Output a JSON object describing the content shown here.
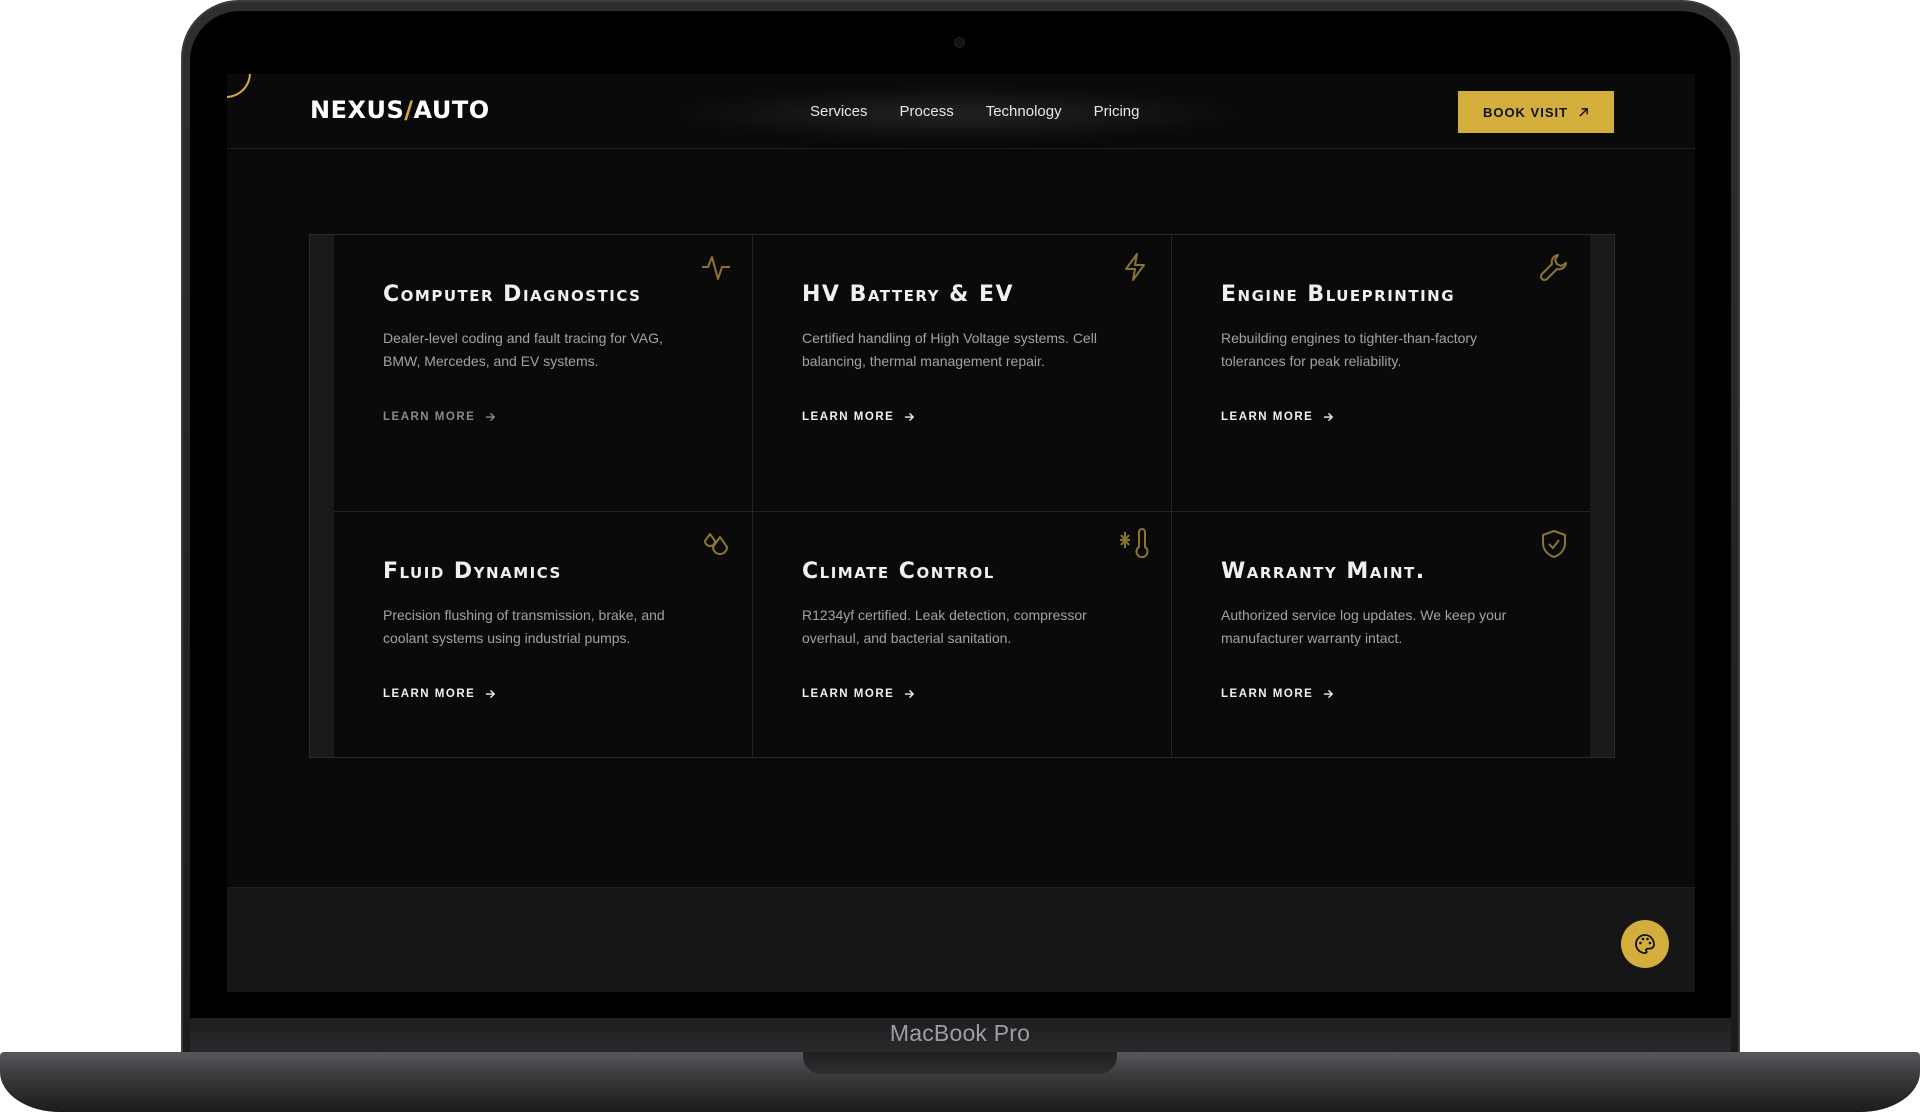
{
  "brand": {
    "name_left": "NEXUS",
    "separator": "/",
    "name_right": "AUTO"
  },
  "nav": {
    "links": [
      "Services",
      "Process",
      "Technology",
      "Pricing"
    ],
    "cta_label": "BOOK VISIT",
    "cta_icon": "arrow-up-right-icon"
  },
  "services": [
    {
      "title": "Computer Diagnostics",
      "desc": "Dealer-level coding and fault tracing for VAG, BMW, Mercedes, and EV systems.",
      "link": "LEARN MORE",
      "icon": "activity-pulse-icon"
    },
    {
      "title": "HV Battery & EV",
      "desc": "Certified handling of High Voltage systems. Cell balancing, thermal management repair.",
      "link": "LEARN MORE",
      "icon": "lightning-bolt-icon"
    },
    {
      "title": "Engine Blueprinting",
      "desc": "Rebuilding engines to tighter-than-factory tolerances for peak reliability.",
      "link": "LEARN MORE",
      "icon": "wrench-icon"
    },
    {
      "title": "Fluid Dynamics",
      "desc": "Precision flushing of transmission, brake, and coolant systems using industrial pumps.",
      "link": "LEARN MORE",
      "icon": "droplets-icon"
    },
    {
      "title": "Climate Control",
      "desc": "R1234yf certified. Leak detection, compressor overhaul, and bacterial sanitation.",
      "link": "LEARN MORE",
      "icon": "thermometer-snowflake-icon"
    },
    {
      "title": "Warranty Maint.",
      "desc": "Authorized service log updates. We keep your manufacturer warranty intact.",
      "link": "LEARN MORE",
      "icon": "shield-check-icon"
    }
  ],
  "floating_button": {
    "icon": "palette-icon"
  },
  "device": {
    "label": "MacBook Pro"
  },
  "colors": {
    "accent": "#d4ae3c",
    "background": "#0a0a0a",
    "text": "#f0f0f0",
    "muted": "#a2a2a2"
  }
}
